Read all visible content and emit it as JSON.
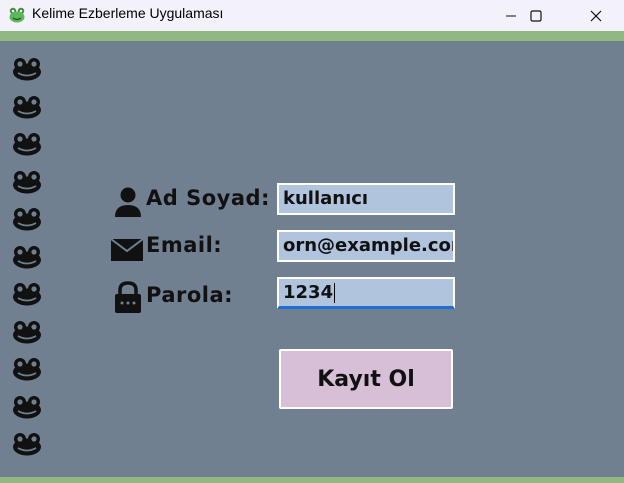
{
  "window": {
    "title": "Kelime Ezberleme Uygulaması",
    "icon": "frog-icon",
    "controls": [
      "minimize-icon",
      "maximize-icon",
      "close-icon"
    ]
  },
  "colors": {
    "background": "#708090",
    "accent_strip": "#90b880",
    "field_bg": "#b0c4de",
    "button_bg": "#d8bfd8",
    "focus_underline": "#1f6fd0"
  },
  "decoration": {
    "frog_icon": "frog-face-icon",
    "frog_count": 11
  },
  "form": {
    "name": {
      "icon": "person-icon",
      "label": "Ad Soyad:",
      "value": "kullanıcı"
    },
    "email": {
      "icon": "envelope-icon",
      "label": "Email:",
      "value": "orn@example.com"
    },
    "password": {
      "icon": "lock-icon",
      "label": "Parola:",
      "value": "1234"
    },
    "submit_label": "Kayıt Ol"
  }
}
